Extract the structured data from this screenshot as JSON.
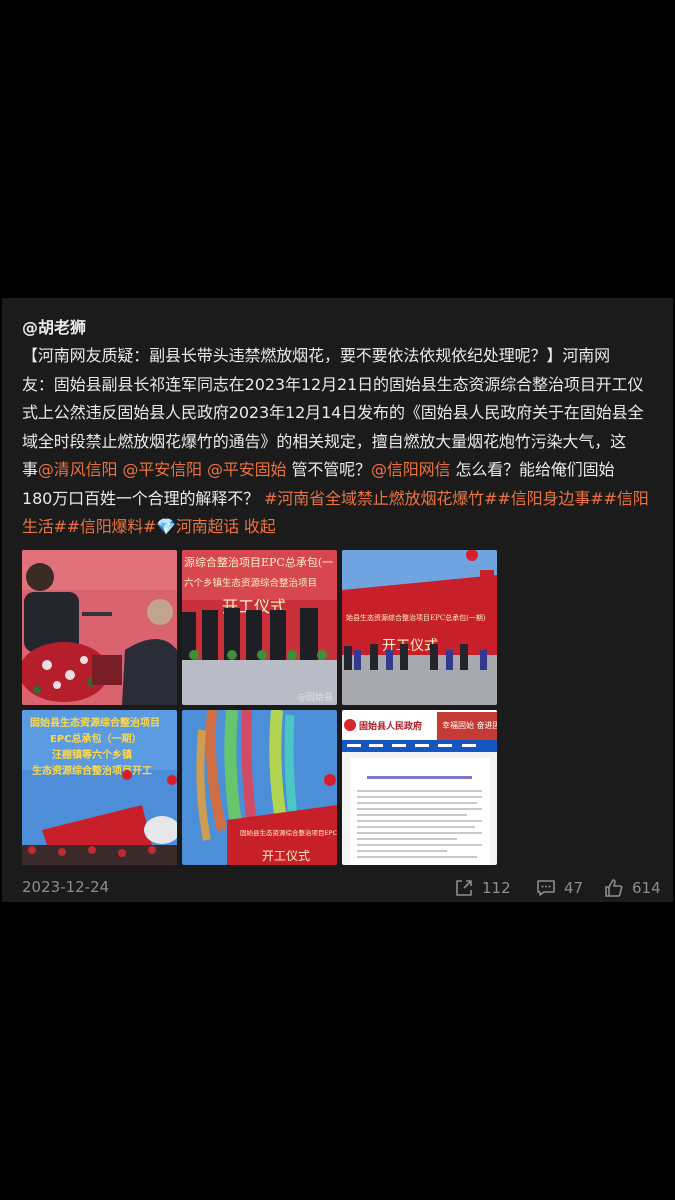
{
  "post": {
    "author": "@胡老狮",
    "lines": [
      [
        {
          "t": "【河南网友质疑：副县长带头违禁燃放烟花，要不要依法依规依纪处理呢？】河南网",
          "link": false
        }
      ],
      [
        {
          "t": "友：固始县副县长祁连军同志在2023年12月21日的固始县生态资源综合整治项目开工仪",
          "link": false
        }
      ],
      [
        {
          "t": "式上公然违反固始县人民政府2023年12月14日发布的《固始县人民政府关于在固始县全",
          "link": false
        }
      ],
      [
        {
          "t": "域全时段禁止燃放烟花爆竹的通告》的相关规定，擅自燃放大量烟花炮竹污染大气，这",
          "link": false
        }
      ],
      [
        {
          "t": "事",
          "link": false
        },
        {
          "t": "@清风信阳",
          "link": true
        },
        {
          "t": " ",
          "link": false
        },
        {
          "t": "@平安信阳",
          "link": true
        },
        {
          "t": " ",
          "link": false
        },
        {
          "t": "@平安固始",
          "link": true
        },
        {
          "t": " 管不管呢？",
          "link": false
        },
        {
          "t": "@信阳网信",
          "link": true
        },
        {
          "t": " 怎么看？能给俺们固始",
          "link": false
        }
      ],
      [
        {
          "t": "180万口百姓一个合理的解释不？ ",
          "link": false
        },
        {
          "t": "#河南省全域禁止燃放烟花爆竹##信阳身边事##信阳",
          "link": true
        }
      ],
      [
        {
          "t": "生活##信阳爆料#",
          "link": true
        },
        {
          "t": "💎",
          "link": true
        },
        {
          "t": "河南超话 收起",
          "link": true
        }
      ]
    ],
    "images": [
      {
        "name": "speaker-photo",
        "desc": "speaker at podium"
      },
      {
        "name": "ceremony-stage-photo",
        "banner": "源综合整治项目EPC总承包(一",
        "banner2": "六个乡镇生态资源综合整治项目",
        "sign": "开工仪式",
        "watermark": "@固始县"
      },
      {
        "name": "outdoor-stage-photo",
        "banner": "始县生态资源综合整治项目EPC总承包(一期)",
        "sign": "开工仪式"
      },
      {
        "name": "blue-banner-photo",
        "banner": "固始县生态资源综合整治项目\nEPC总承包（一期）\n汪棚镇等六个乡镇\n生态资源综合整治项目开工"
      },
      {
        "name": "colored-smoke-photo",
        "banner": "固始县生态资源综合整治项目EPC总承包",
        "sign": "开工仪式"
      },
      {
        "name": "government-site-screenshot",
        "site": "固始县人民政府",
        "slogan": "幸福固始 奋进固始",
        "notice": "固始县人民政府关于在固始县全域全时段禁止燃放烟花爆竹的通告"
      }
    ],
    "date": "2023-12-24",
    "shares": "112",
    "comments": "47",
    "likes": "614"
  },
  "colors": {
    "background": "#000000",
    "card": "#1b1b1b",
    "text": "#e9e9e9",
    "link": "#eb7340",
    "meta": "#8d8d8d"
  }
}
